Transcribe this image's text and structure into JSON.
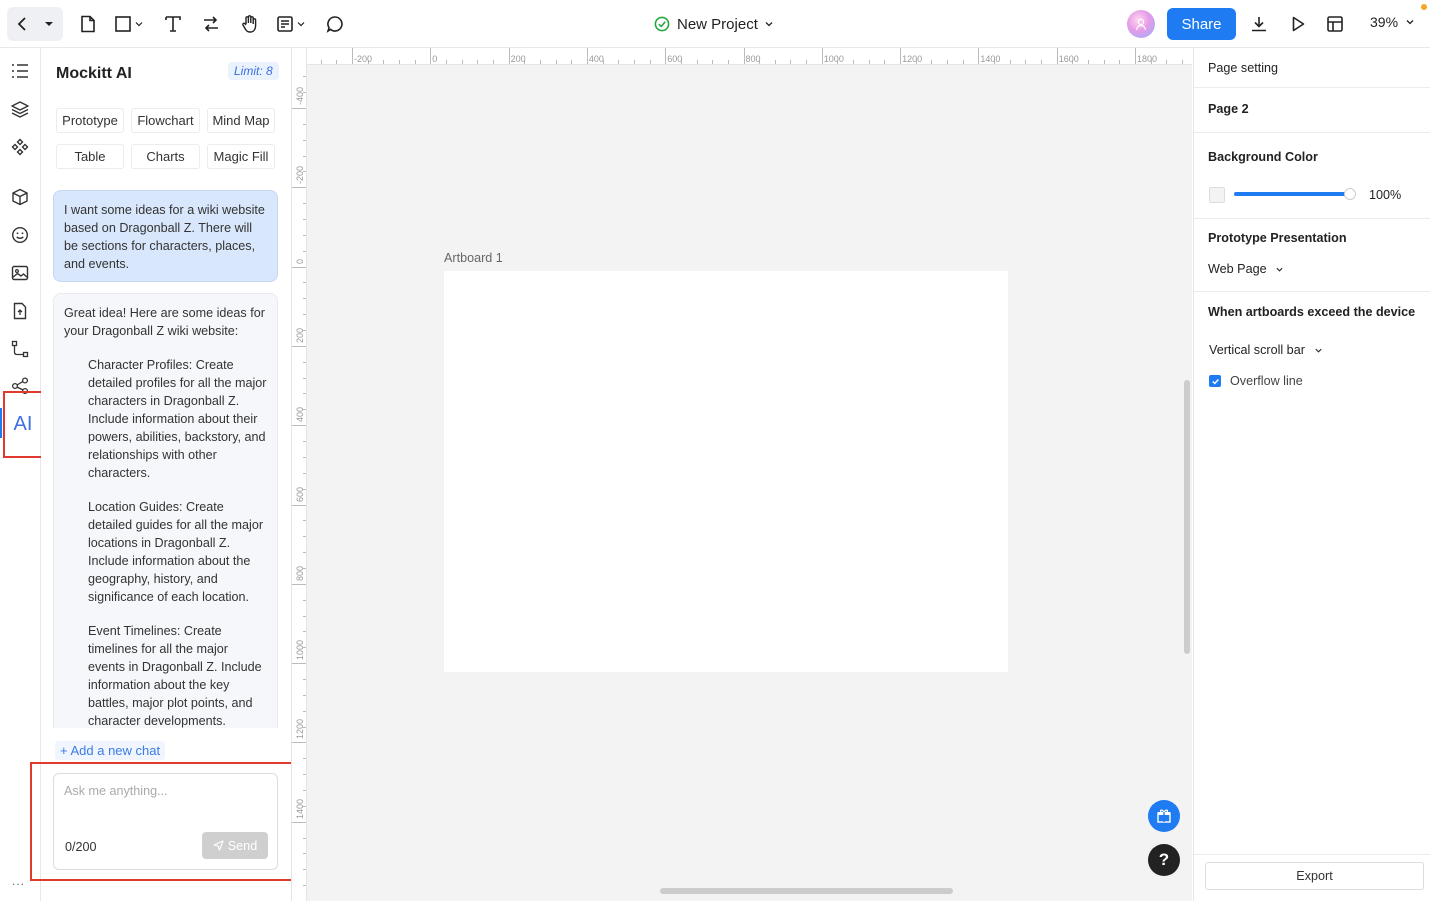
{
  "topbar": {
    "project_title": "New Project",
    "share_label": "Share",
    "zoom_label": "39%"
  },
  "ai_panel": {
    "title": "Mockitt AI",
    "limit_label": "Limit: 8",
    "chips": [
      "Prototype",
      "Flowchart",
      "Mind Map",
      "Table",
      "Charts",
      "Magic Fill"
    ],
    "user_message": "I want some ideas for a wiki website based on Dragonball Z. There will be sections for characters, places, and events.",
    "ai_intro": "Great idea! Here are some ideas for your Dragonball Z wiki website:",
    "ai_items": [
      "Character Profiles: Create detailed profiles for all the major characters in Dragonball Z. Include information about their powers, abilities, backstory, and relationships with other characters.",
      "Location Guides: Create detailed guides for all the major locations in Dragonball Z. Include information about the geography, history, and significance of each location.",
      "Event Timelines: Create timelines for all the major events in Dragonball Z. Include information about the key battles, major plot points, and character developments."
    ],
    "new_chat_label": "+ Add a new chat",
    "input_placeholder": "Ask me anything...",
    "char_count": "0/200",
    "send_label": "Send"
  },
  "rail": {
    "ai_label": "AI",
    "more_label": "..."
  },
  "ruler": {
    "h_labels": [
      "-200",
      "0",
      "200",
      "400",
      "600",
      "800",
      "1000",
      "1200",
      "1400",
      "1600",
      "1800"
    ],
    "v_labels": [
      "-400",
      "-200",
      "0",
      "200",
      "400",
      "600",
      "800",
      "1000",
      "1200",
      "1400"
    ]
  },
  "canvas": {
    "artboard_label": "Artboard 1",
    "help_label": "?"
  },
  "right_panel": {
    "page_setting": "Page setting",
    "page_name": "Page 2",
    "bg_color_label": "Background Color",
    "bg_opacity": "100%",
    "bg_opacity_value": 100,
    "proto_label": "Prototype Presentation",
    "proto_value": "Web Page",
    "exceed_label": "When artboards exceed the device",
    "exceed_value": "Vertical scroll bar",
    "overflow_label": "Overflow line",
    "overflow_checked": true,
    "export_label": "Export"
  },
  "colors": {
    "accent": "#1e7bf2",
    "highlight": "#e03a2f",
    "user_bubble": "#d8e7fb"
  }
}
